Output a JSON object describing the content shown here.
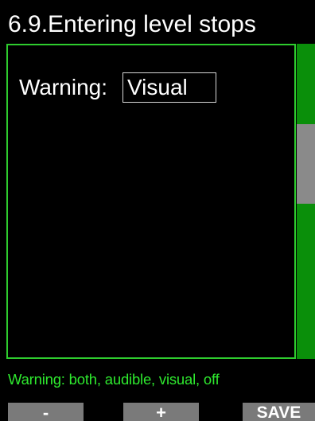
{
  "header": {
    "title": "6.9.Entering level stops"
  },
  "setting": {
    "label": "Warning:",
    "value": "Visual"
  },
  "hint": {
    "text": "Warning: both, audible, visual, off"
  },
  "softkeys": {
    "minus_label": "-",
    "plus_label": "+",
    "save_label": "SAVE"
  },
  "scrollbar": {
    "position_fraction": 0.25
  },
  "colors": {
    "background": "#000000",
    "accent": "#2ecc2e",
    "scroll_track": "#0a8f0a",
    "softkey": "#7a7a7a",
    "text": "#ffffff"
  }
}
